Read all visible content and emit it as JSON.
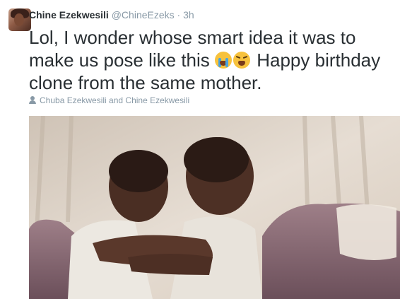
{
  "tweet": {
    "display_name": "Chine Ezekwesili",
    "handle": "@ChineEzeks",
    "separator": "·",
    "timestamp": "3h",
    "text_part1": "Lol, I wonder whose smart idea it was to make us pose like this ",
    "text_part2": " Happy birthday clone from the same mother.",
    "emojis": [
      "crying-face-emoji",
      "tired-face-emoji"
    ],
    "tagged_people": "Chuba Ezekwesili and Chine Ezekwesili"
  },
  "colors": {
    "name": "#292f33",
    "meta": "#8899a6",
    "text": "#292f33"
  }
}
